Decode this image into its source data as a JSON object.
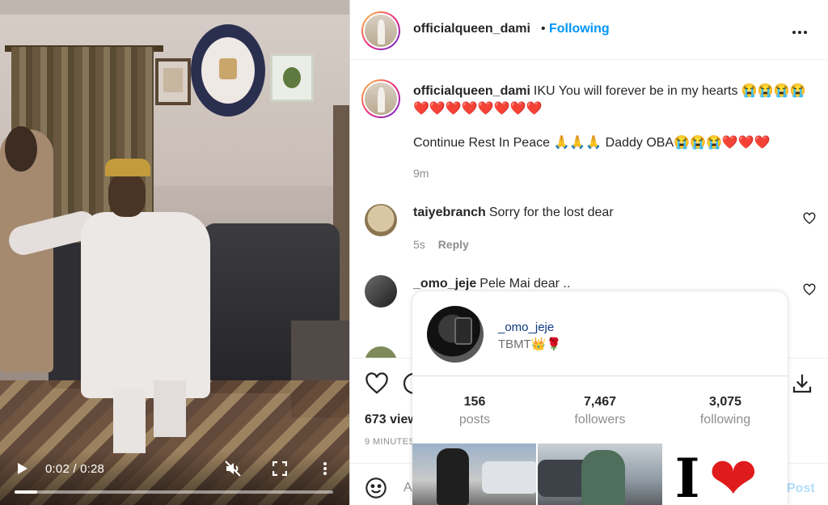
{
  "video": {
    "time": "0:02 / 0:28",
    "progress_fraction": 0.0714
  },
  "header": {
    "username": "officialqueen_dami",
    "separator": "•",
    "follow_status": "Following",
    "more_icon": "more-horizontal-icon"
  },
  "caption": {
    "username": "officialqueen_dami",
    "line1": "IKU You will forever be in my hearts 😭😭😭😭 ❤️❤️❤️❤️❤️❤️❤️❤️",
    "line2": "Continue Rest In Peace 🙏🙏🙏 Daddy OBA😭😭😭❤️❤️❤️",
    "time": "9m"
  },
  "comments": [
    {
      "username": "taiyebranch",
      "text": "Sorry for the lost dear",
      "time": "5s",
      "reply_label": "Reply"
    },
    {
      "username": "_omo_jeje",
      "text": "Pele Mai dear .."
    }
  ],
  "actions": {
    "like_icon": "heart-outline-icon",
    "comment_icon": "comment-icon",
    "save_icon": "download-icon"
  },
  "views_label": "673 views",
  "posted_label": "9 MINUTES AGO",
  "add_comment": {
    "emoji_icon": "smiley-icon",
    "placeholder": "Add a comment...",
    "post_label": "Post"
  },
  "hover_card": {
    "username": "_omo_jeje",
    "bio": "TBMT👑🌹",
    "stats": [
      {
        "value": "156",
        "label": "posts"
      },
      {
        "value": "7,467",
        "label": "followers"
      },
      {
        "value": "3,075",
        "label": "following"
      }
    ],
    "third_photo_letter": "I",
    "third_photo_heart": "❤"
  },
  "colors": {
    "link_blue": "#0095f6",
    "post_disabled": "#b2dffc",
    "secondary_text": "#8e8e8e"
  }
}
